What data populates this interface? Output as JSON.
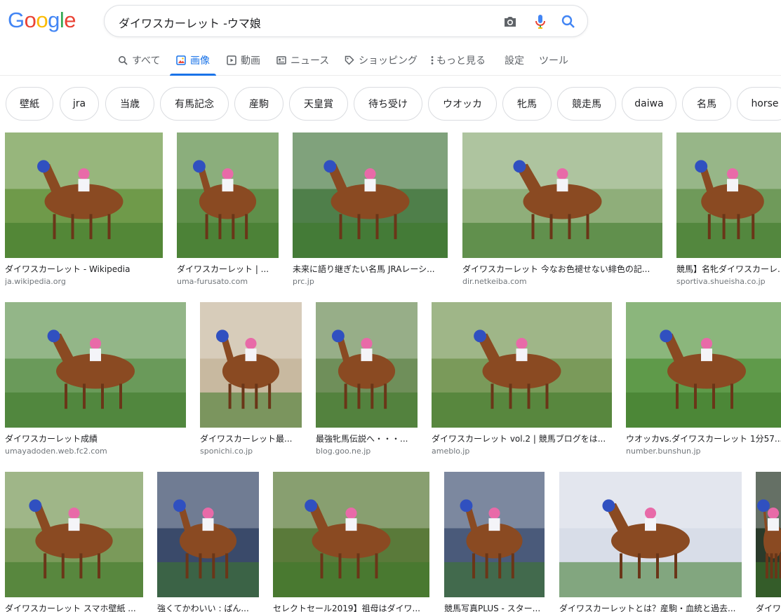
{
  "header": {
    "logo_letters": [
      "G",
      "o",
      "o",
      "g",
      "l",
      "e"
    ],
    "logo_colors": [
      "#4285F4",
      "#EA4335",
      "#FBBC05",
      "#4285F4",
      "#34A853",
      "#EA4335"
    ],
    "query": "ダイワスカーレット -ウマ娘",
    "icons": [
      "camera-icon",
      "microphone-icon",
      "search-icon"
    ]
  },
  "tabs": [
    {
      "label": "すべて",
      "icon": "search-icon"
    },
    {
      "label": "画像",
      "icon": "image-icon",
      "active": true
    },
    {
      "label": "動画",
      "icon": "play-icon"
    },
    {
      "label": "ニュース",
      "icon": "news-icon"
    },
    {
      "label": "ショッピング",
      "icon": "tag-icon"
    },
    {
      "label": "もっと見る",
      "icon": "more-vert-icon"
    },
    {
      "label": "設定"
    },
    {
      "label": "ツール"
    }
  ],
  "chips": [
    "壁紙",
    "jra",
    "当歳",
    "有馬記念",
    "産駒",
    "天皇賞",
    "待ち受け",
    "ウオッカ",
    "牝馬",
    "競走馬",
    "daiwa",
    "名馬",
    "horse"
  ],
  "results": [
    {
      "title": "ダイワスカーレット - Wikipedia",
      "site": "ja.wikipedia.org",
      "bg": "#6f9a4a"
    },
    {
      "title": "ダイワスカーレット | ...",
      "site": "uma-furusato.com",
      "bg": "#5f8f4a"
    },
    {
      "title": "未来に語り継ぎたい名馬 JRAレーシ...",
      "site": "prc.jp",
      "bg": "#4f7f4a"
    },
    {
      "title": "ダイワスカーレット 今なお色褪せない緋色の記...",
      "site": "dir.netkeiba.com",
      "bg": "#8fae7a"
    },
    {
      "title": "競馬】名牝ダイワスカーレ...",
      "site": "sportiva.shueisha.co.jp",
      "bg": "#6f9a5a"
    },
    {
      "title": "ダイワスカーレット成績",
      "site": "umayadoden.web.fc2.com",
      "bg": "#6a9a5a"
    },
    {
      "title": "ダイワスカーレット最...",
      "site": "sponichi.co.jp",
      "bg": "#c8b9a0"
    },
    {
      "title": "最強牝馬伝説へ・・・...",
      "site": "blog.goo.ne.jp",
      "bg": "#6f8f5a"
    },
    {
      "title": "ダイワスカーレット vol.2 | 競馬ブログをは...",
      "site": "ameblo.jp",
      "bg": "#7a9a5a"
    },
    {
      "title": "ウオッカvs.ダイワスカーレット 1分57...",
      "site": "number.bunshun.jp",
      "bg": "#5f9a4a"
    },
    {
      "title": "ダイワスカーレット スマホ壁紙 ...",
      "site": "",
      "bg": "#7a9a5a"
    },
    {
      "title": "強くてかわいい : ぱん...",
      "site": "",
      "bg": "#3a4a6a"
    },
    {
      "title": "セレクトセール2019】祖母はダイワ...",
      "site": "",
      "bg": "#5a7a3a"
    },
    {
      "title": "競馬写真PLUS - スター...",
      "site": "",
      "bg": "#4a5a7a"
    },
    {
      "title": "ダイワスカーレットとは？産駒・血統と過去...",
      "site": "",
      "bg": "#d8dde8"
    },
    {
      "title": "ダイワ...",
      "site": "",
      "bg": "#2a3a2a"
    }
  ]
}
